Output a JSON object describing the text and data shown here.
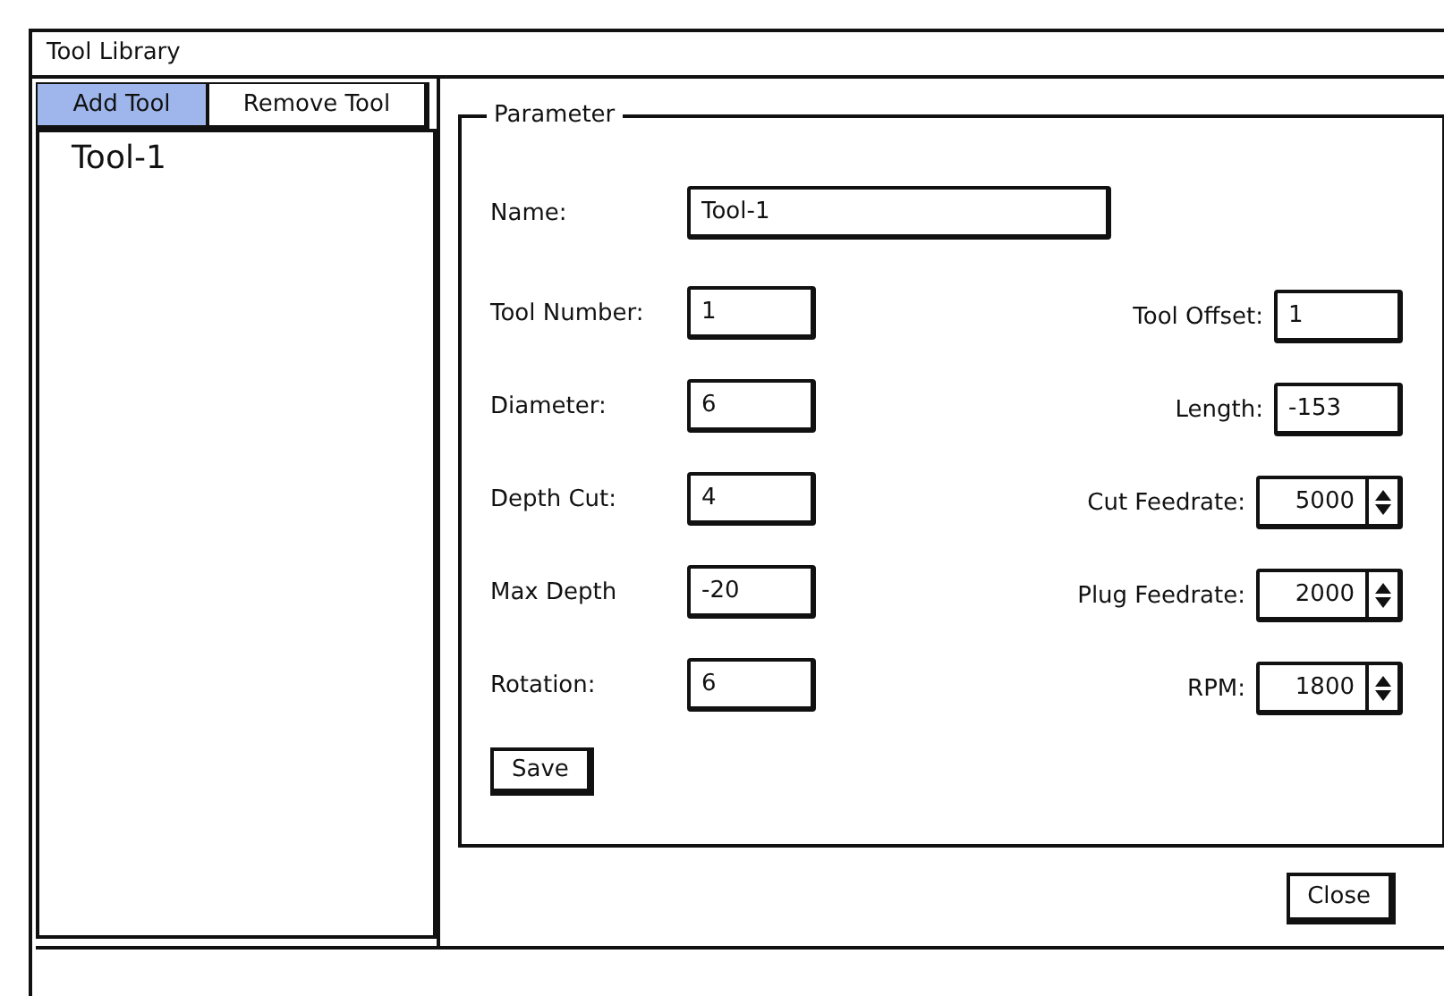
{
  "window": {
    "title": "Tool Library"
  },
  "tabs": [
    {
      "label": "Add Tool",
      "selected": true
    },
    {
      "label": "Remove Tool",
      "selected": false
    }
  ],
  "tool_list": {
    "items": [
      {
        "label": "Tool-1",
        "selected": false
      }
    ]
  },
  "parameter_group": {
    "title": "Parameter",
    "name_field": {
      "label": "Name:",
      "value": "Tool-1"
    },
    "left_fields": [
      {
        "label": "Tool Number:",
        "value": "1"
      },
      {
        "label": "Diameter:",
        "value": "6"
      },
      {
        "label": "Depth Cut:",
        "value": "4"
      },
      {
        "label": "Max Depth",
        "value": "-20"
      },
      {
        "label": "Rotation:",
        "value": "6"
      }
    ],
    "right_fields": [
      {
        "label": "Tool Offset:",
        "value": "1",
        "kind": "text"
      },
      {
        "label": "Length:",
        "value": "-153",
        "kind": "text"
      },
      {
        "label": "Cut Feedrate:",
        "value": "5000",
        "kind": "spinner"
      },
      {
        "label": "Plug Feedrate:",
        "value": "2000",
        "kind": "spinner"
      },
      {
        "label": "RPM:",
        "value": "1800",
        "kind": "spinner"
      }
    ],
    "save_button": "Save"
  },
  "close_button": "Close"
}
